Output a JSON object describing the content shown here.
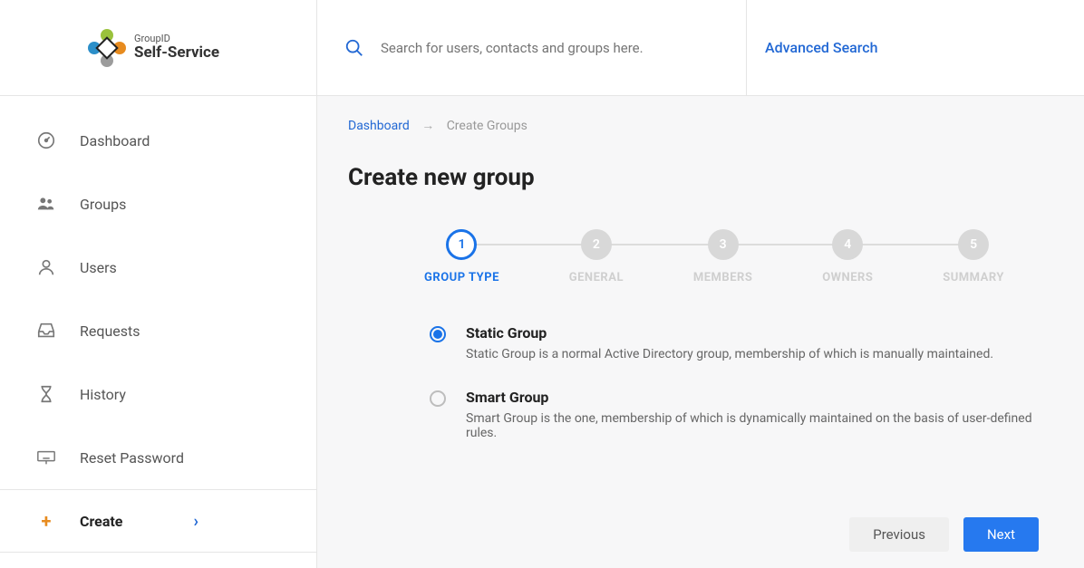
{
  "logo": {
    "small": "GroupID",
    "big": "Self-Service"
  },
  "search": {
    "placeholder": "Search for users, contacts and groups here."
  },
  "advanced_search": "Advanced Search",
  "sidebar": {
    "items": [
      {
        "label": "Dashboard"
      },
      {
        "label": "Groups"
      },
      {
        "label": "Users"
      },
      {
        "label": "Requests"
      },
      {
        "label": "History"
      },
      {
        "label": "Reset Password"
      }
    ],
    "create": "Create"
  },
  "breadcrumb": {
    "root": "Dashboard",
    "current": "Create Groups"
  },
  "page_title": "Create new group",
  "steps": [
    {
      "num": "1",
      "label": "GROUP TYPE"
    },
    {
      "num": "2",
      "label": "GENERAL"
    },
    {
      "num": "3",
      "label": "MEMBERS"
    },
    {
      "num": "4",
      "label": "OWNERS"
    },
    {
      "num": "5",
      "label": "SUMMARY"
    }
  ],
  "options": [
    {
      "title": "Static Group",
      "desc": "Static Group is a normal Active Directory group, membership of which is manually maintained."
    },
    {
      "title": "Smart Group",
      "desc": "Smart Group is the one, membership of which is dynamically maintained on the basis of user-defined rules."
    }
  ],
  "buttons": {
    "prev": "Previous",
    "next": "Next"
  }
}
